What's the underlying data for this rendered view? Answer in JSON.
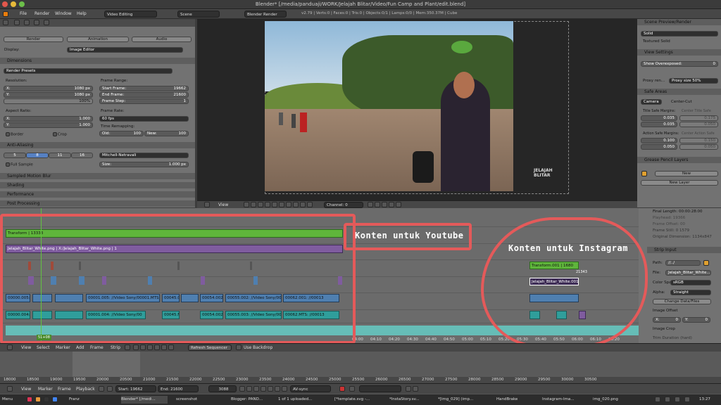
{
  "window": {
    "title": "Blender* [/media/panduaji/WORK/Jelajah Blitar/Video/Fun Camp and Plant/edit.blend]"
  },
  "menubar": {
    "menus": [
      "File",
      "Render",
      "Window",
      "Help"
    ],
    "layout": "Video Editing",
    "scene": "Scene",
    "engine": "Blender Render",
    "stats": "v2.79 | Verts:0 | Faces:0 | Tris:0 | Objects:0/1 | Lamps:0/0 | Mem:350.37M | Cube"
  },
  "props": {
    "tabs": [
      "Render",
      "Animation",
      "Audio"
    ],
    "display_label": "Display:",
    "display_value": "Image Editor",
    "dimensions_title": "Dimensions",
    "render_presets": "Render Presets",
    "resolution_label": "Resolution:",
    "res_x": "X:",
    "res_x_val": "1080 px",
    "res_y": "Y:",
    "res_y_val": "1080 px",
    "res_pct": "100%",
    "frame_range_label": "Frame Range:",
    "start_label": "Start Frame:",
    "start_val": "19662",
    "end_label": "End Frame:",
    "end_val": "21600",
    "step_label": "Frame Step:",
    "step_val": "1",
    "aspect_label": "Aspect Ratio:",
    "asp_x": "X:",
    "asp_x_val": "1.000",
    "asp_y": "Y:",
    "asp_y_val": "1.000",
    "frame_rate_label": "Frame Rate:",
    "fps": "60 fps",
    "time_remap": "Time Remapping:",
    "old_label": "Old:",
    "old_val": "100",
    "new_label": "New:",
    "new_val": "100",
    "border": "Border",
    "crop": "Crop",
    "aa_title": "Anti-Aliasing",
    "aa_samples": [
      "5",
      "8",
      "11",
      "16"
    ],
    "aa_filter": "Mitchell-Netravali",
    "full_sample": "Full Sample",
    "size_label": "Size:",
    "size_val": "1.000 px",
    "sections": [
      "Sampled Motion Blur",
      "Shading",
      "Performance",
      "Post Processing"
    ]
  },
  "viewer": {
    "view_menu": "View",
    "channel": "Channel:",
    "channel_val": "0",
    "watermark": "JELAJAH BLITAR"
  },
  "rpanel": {
    "scene_preview": "Scene Preview/Render",
    "solid": "Solid",
    "textured_solid": "Textured Solid",
    "view_settings": "View Settings",
    "show_overexposed": "Show Overexposed:",
    "show_overexposed_val": "0",
    "proxy_render": "Proxy ren...",
    "proxy_size": "Proxy size 50%",
    "safe_areas": "Safe Areas",
    "camera": "Camera",
    "center_cut": "Center-Cut",
    "title_safe": "Title Safe Margins:",
    "center_title_safe": "Center Title Safe",
    "ts_x": "0.035",
    "ts_y": "0.035",
    "cts_x": "0.175",
    "cts_y": "0.050",
    "action_safe": "Action Safe Margins:",
    "center_action_safe": "Center Action Safe",
    "as_x": "0.100",
    "as_y": "0.050",
    "cas_x": "0.150",
    "cas_y": "0.050",
    "grease_pencil": "Grease Pencil Layers",
    "new": "New",
    "new_layer": "New Layer"
  },
  "sequencer": {
    "strip_green_1": "Transform | 13333",
    "strip_purple_1": "Jelajah_Blitar_White.png | X:/Jelajah_Blitar_White.png | 1",
    "movie_1": "00000.005:",
    "movie_2": "00001.005: //Video Sony/00001.MTS",
    "movie_3": "00045.0",
    "movie_4": "00054.002:",
    "movie_5": "00055.002: //Video Sony/00",
    "movie_6": "00062.001: //00013",
    "sound_1": "00000.004:",
    "sound_2": "00001.004: //Video Sony/00",
    "sound_3": "00045.M",
    "sound_4": "00054.002",
    "sound_5": "00055.003: //Video Sony/00",
    "sound_6": "00062.MTS: //00013",
    "strip_green_2": "Transform.001 | 1680",
    "strip_purple_2": "Jelajah_Blitar_White.001",
    "frame_marker": "21343",
    "current_frame": "51+08",
    "time_ticks": [
      "04:00",
      "04:10",
      "04:20",
      "04:30",
      "04:40",
      "04:50",
      "05:00",
      "05:10",
      "05:20",
      "05:30",
      "05:40",
      "05:50",
      "06:00",
      "06:10",
      "06:20"
    ]
  },
  "strip_panel": {
    "final_length": "Final Length: 00:00:28:00",
    "playhead": "Playhead: 19366",
    "frame_offset": "Frame Offset: 00",
    "frame_still": "Frame Still: 0 1579",
    "original_dim": "Original Dimension: 1134x847",
    "strip_input": "Strip Input",
    "path_label": "Path:",
    "path_val": "//../",
    "file_label": "File:",
    "file_val": "Jelajah_Blitar_White...",
    "color_space_label": "Color Spa:",
    "color_space_val": "sRGB",
    "alpha_label": "Alpha:",
    "alpha_val": "Straight",
    "change_data": "Change Data/Files",
    "image_offset": "Image Offset",
    "offset_x": "X:",
    "offset_x_val": "0",
    "offset_y": "Y:",
    "offset_y_val": "0",
    "image_crop": "Image Crop",
    "trim": "Trim Duration (hard)"
  },
  "seqbar": {
    "items": [
      "View",
      "Select",
      "Marker",
      "Add",
      "Frame",
      "Strip"
    ],
    "refresh": "Refresh Sequencer",
    "backdrop": "Use Backdrop"
  },
  "timeline": {
    "ticks": [
      "18000",
      "18500",
      "19000",
      "19500",
      "20000",
      "20500",
      "21000",
      "21500",
      "22000",
      "22500",
      "23000",
      "23500",
      "24000",
      "24500",
      "25000",
      "25500",
      "26000",
      "26500",
      "27000",
      "27500",
      "28000",
      "28500",
      "29000",
      "29500",
      "30000",
      "30500"
    ]
  },
  "tlbar": {
    "items": [
      "View",
      "Marker",
      "Frame",
      "Playback"
    ],
    "start_label": "Start:",
    "start_val": "19662",
    "end_label": "End:",
    "end_val": "21600",
    "current": "3088",
    "sync": "AV-sync"
  },
  "annotations": {
    "youtube": "Konten untuk Youtube",
    "instagram": "Konten untuk Instagram"
  },
  "taskbar": {
    "menu": "Menu",
    "apps": [
      "Franz",
      "Blender* [/medi...",
      "screenshot",
      "Blogger: PAND...",
      "1 of 1 uploaded...",
      "[*template.svg -...",
      "*InstaStory.sv...",
      "*[img_029] (imp...",
      "HandBrake",
      "Instagram-Ima...",
      "img_020.png"
    ],
    "clock": "13:27"
  }
}
